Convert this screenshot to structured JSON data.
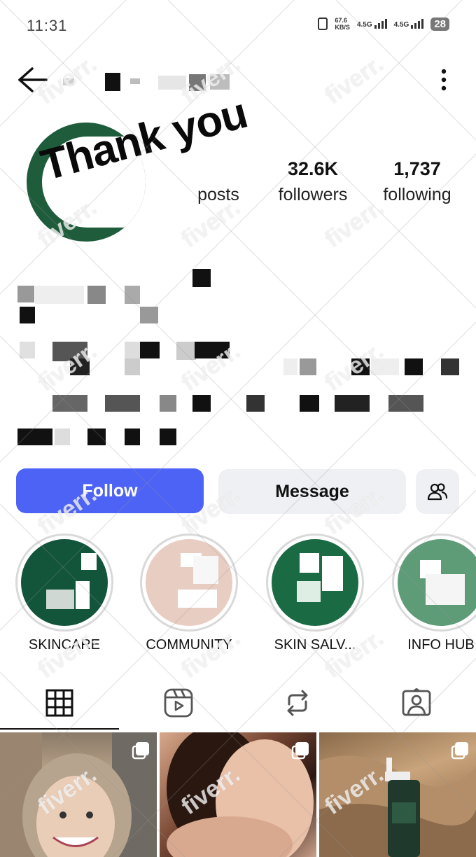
{
  "status_bar": {
    "time": "11:31",
    "speed_top": "67.6",
    "speed_bottom": "KB/S",
    "network_1": "4.5G",
    "network_2": "4.5G",
    "battery": "28"
  },
  "header": {
    "back_icon": "arrow-left-icon",
    "more_icon": "more-vertical-icon"
  },
  "sticker_text": "Thank you",
  "stats": {
    "posts": {
      "value": "",
      "label": "posts"
    },
    "followers": {
      "value": "32.6K",
      "label": "followers"
    },
    "following": {
      "value": "1,737",
      "label": "following"
    }
  },
  "actions": {
    "follow": "Follow",
    "message": "Message",
    "suggest_icon": "add-person-icon"
  },
  "highlights": [
    {
      "label": "SKINCARE",
      "color": "#13553a"
    },
    {
      "label": "COMMUNITY",
      "color": "#e8cdc3"
    },
    {
      "label": "SKIN SALV...",
      "color": "#1a6b44"
    },
    {
      "label": "INFO HUB",
      "color": "#5e9c78"
    }
  ],
  "tabs": [
    {
      "icon": "grid-icon"
    },
    {
      "icon": "reels-icon"
    },
    {
      "icon": "reposts-icon"
    },
    {
      "icon": "tagged-icon"
    }
  ],
  "watermark_text": "fiverr.",
  "colors": {
    "follow_button": "#4d63f5",
    "secondary_button": "#eff0f3",
    "brand_green": "#1e5c3c"
  }
}
